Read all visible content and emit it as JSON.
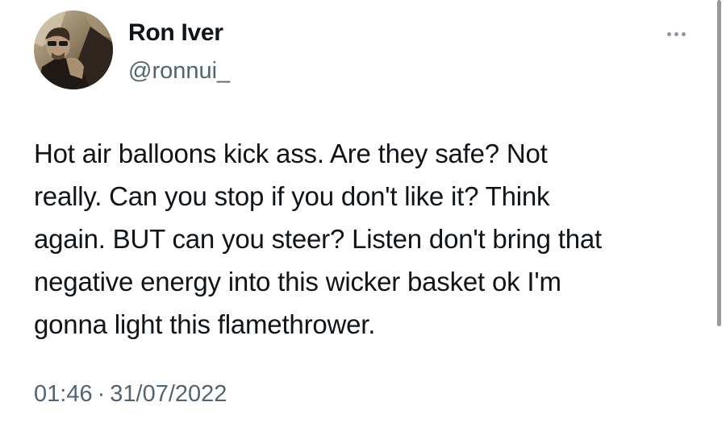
{
  "author": {
    "display_name": "Ron Iver",
    "handle": "@ronnui_",
    "avatar_icon": "profile-photo"
  },
  "menu": {
    "icon": "more-horizontal-icon"
  },
  "tweet": {
    "lines": [
      "Hot air balloons kick ass. Are they safe? Not",
      "really. Can you stop if you don't like it? Think",
      "again. BUT can you steer? Listen don't bring that",
      "negative energy into this wicker basket ok I'm",
      "gonna light this flamethrower."
    ],
    "time": "01:46",
    "separator": "·",
    "date": "31/07/2022"
  },
  "colors": {
    "text": "#0f1419",
    "secondary": "#536471",
    "dots": "#8b98a5",
    "scrollbar": "#9a9a9a"
  }
}
